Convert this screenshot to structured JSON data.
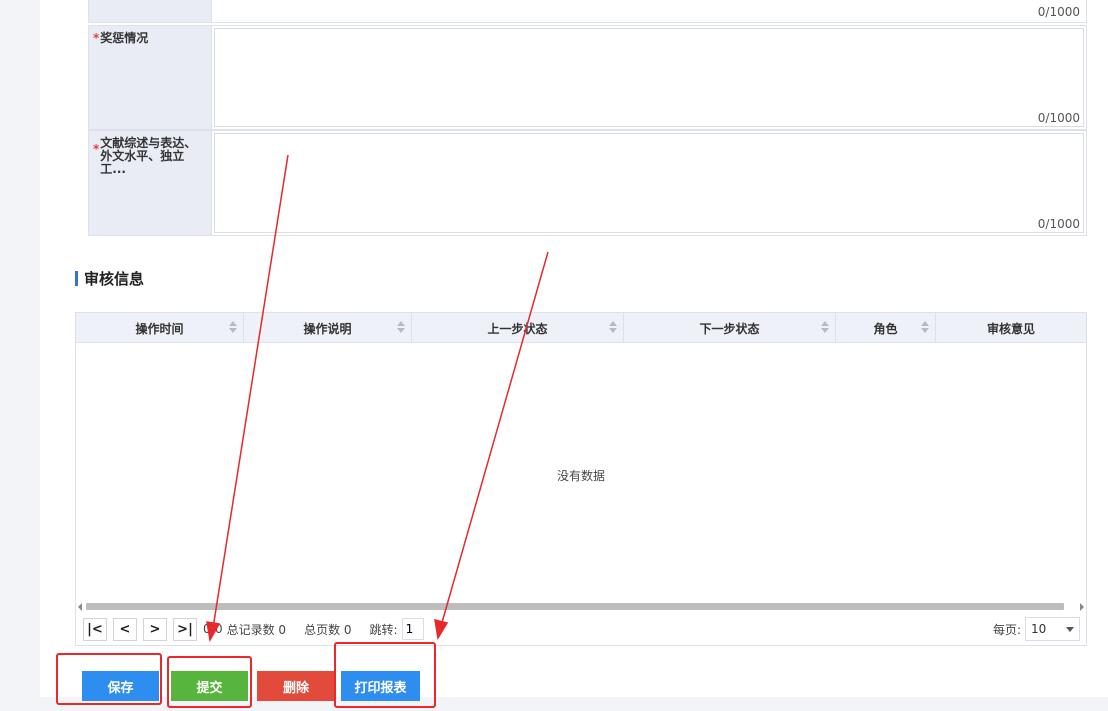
{
  "form": {
    "top_counter": "0/1000",
    "rows": [
      {
        "required_mark": "*",
        "label": "奖惩情况",
        "counter": "0/1000"
      },
      {
        "required_mark": "*",
        "label": "文献综述与表达、外文水平、独立工...",
        "counter": "0/1000"
      }
    ]
  },
  "review_section": {
    "title": "审核信息",
    "columns": [
      "操作时间",
      "操作说明",
      "上一步状态",
      "下一步状态",
      "角色",
      "审核意见"
    ],
    "empty_text": "没有数据"
  },
  "pager": {
    "first": "|<",
    "prev": "<",
    "next": ">",
    "last": ">|",
    "range": "0-0",
    "total_records": "总记录数 0",
    "total_pages": "总页数 0",
    "jump_label": "跳转:",
    "jump_value": "1",
    "per_page_label": "每页:",
    "per_page_value": "10"
  },
  "actions": {
    "save": "保存",
    "submit": "提交",
    "delete": "删除",
    "print": "打印报表"
  },
  "colors": {
    "save": "#2e8ef0",
    "submit": "#57b43c",
    "delete": "#e24b3b",
    "print": "#2e8ef0",
    "annotation": "#e8282b"
  }
}
